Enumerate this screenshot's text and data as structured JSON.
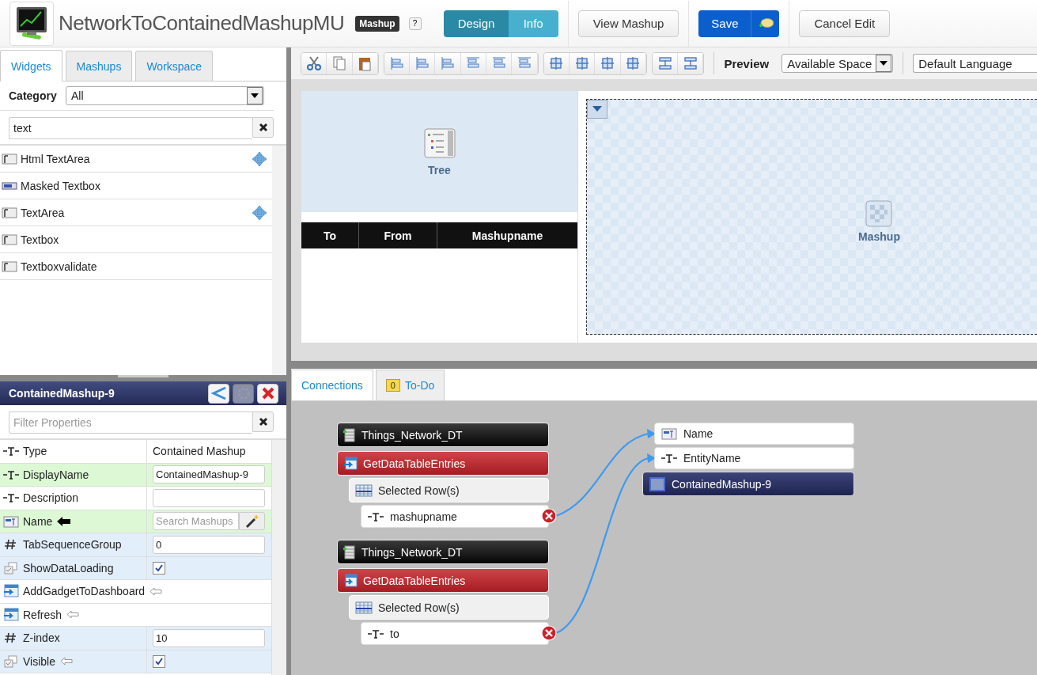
{
  "header": {
    "title": "NetworkToContainedMashupMU",
    "badge": "Mashup",
    "help": "?",
    "mode_tabs": [
      {
        "label": "Design",
        "selected": true
      },
      {
        "label": "Info",
        "selected": false
      }
    ],
    "buttons": [
      {
        "kind": "plain",
        "label": "View Mashup"
      },
      {
        "kind": "primary",
        "label": "Save"
      },
      {
        "kind": "plain",
        "label": "Cancel Edit"
      }
    ]
  },
  "left_tabs": [
    {
      "label": "Widgets",
      "selected": true
    },
    {
      "label": "Mashups",
      "selected": false
    },
    {
      "label": "Workspace",
      "selected": false
    }
  ],
  "category": {
    "label": "Category",
    "value": "All"
  },
  "widget_search": {
    "value": "text"
  },
  "widgets": [
    {
      "kind": "textarea",
      "label": "Html TextArea",
      "movable": true
    },
    {
      "kind": "masked",
      "label": "Masked Textbox",
      "movable": false
    },
    {
      "kind": "textarea",
      "label": "TextArea",
      "movable": true
    },
    {
      "kind": "textarea",
      "label": "Textbox",
      "movable": false
    },
    {
      "kind": "textarea",
      "label": "Textboxvalidate",
      "movable": false
    }
  ],
  "properties": {
    "title": "ContainedMashup-9",
    "filter": {
      "placeholder": "Filter Properties"
    },
    "rows": [
      {
        "kind": "string",
        "label": "Type",
        "color": "#ffffff",
        "editor": {
          "kind": "text",
          "value": "Contained Mashup"
        }
      },
      {
        "kind": "string",
        "label": "DisplayName",
        "color": "#dcf8d4",
        "editor": {
          "kind": "input",
          "value": "ContainedMashup-9"
        }
      },
      {
        "kind": "string",
        "label": "Description",
        "color": "#ffffff",
        "editor": {
          "kind": "input"
        }
      },
      {
        "kind": "mashup",
        "label": "Name",
        "color": "#dcf8d4",
        "editor": {
          "kind": "search",
          "placeholder": "Search Mashups"
        },
        "bound": true
      },
      {
        "kind": "number",
        "label": "TabSequenceGroup",
        "color": "#e2eefa",
        "editor": {
          "kind": "input",
          "value": "0"
        }
      },
      {
        "kind": "boolean",
        "label": "ShowDataLoading",
        "color": "#e2eefa",
        "editor": {
          "kind": "checkbox",
          "checked": true
        }
      },
      {
        "kind": "service",
        "label": "AddGadgetToDashboard",
        "color": "#ffffff",
        "bindable": true
      },
      {
        "kind": "service",
        "label": "Refresh",
        "color": "#ffffff",
        "bindable": true
      },
      {
        "kind": "number",
        "label": "Z-index",
        "color": "#e2eefa",
        "editor": {
          "kind": "input",
          "value": "10"
        }
      },
      {
        "kind": "boolean",
        "label": "Visible",
        "color": "#e2eefa",
        "editor": {
          "kind": "checkbox",
          "checked": true
        },
        "bindable": true
      }
    ]
  },
  "toolbar": {
    "preview_label": "Preview",
    "preview_select": "Available Space",
    "language_select": "Default Language"
  },
  "canvas": {
    "tree_label": "Tree",
    "table_columns": [
      "To",
      "From",
      "Mashupname"
    ],
    "mashup_label": "Mashup"
  },
  "bottom_tabs": [
    {
      "label": "Connections",
      "selected": true
    },
    {
      "label": "To-Do",
      "selected": false,
      "count": "0"
    }
  ],
  "connections": {
    "sources": [
      {
        "thing": "Things_Network_DT",
        "service": "GetDataTableEntries",
        "rows": "Selected Row(s)",
        "field": "mashupname"
      },
      {
        "thing": "Things_Network_DT",
        "service": "GetDataTableEntries",
        "rows": "Selected Row(s)",
        "field": "to"
      }
    ],
    "targets": [
      {
        "kind": "mashup",
        "label": "Name"
      },
      {
        "kind": "string",
        "label": "EntityName"
      },
      {
        "kind": "widget",
        "label": "ContainedMashup-9"
      }
    ]
  }
}
